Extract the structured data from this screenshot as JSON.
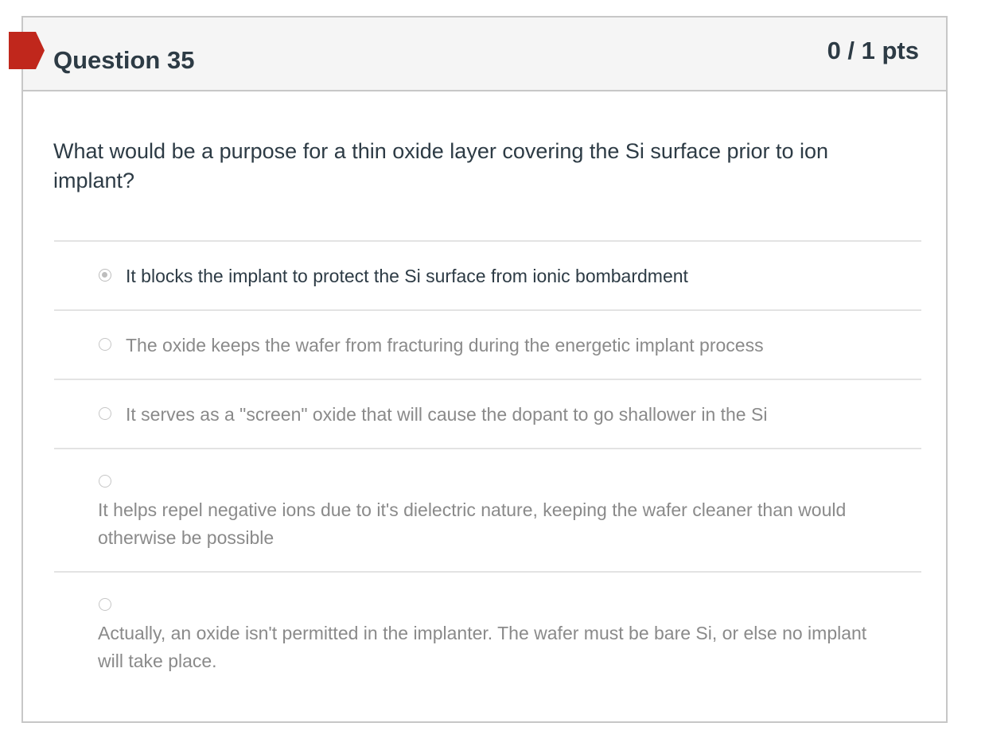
{
  "question": {
    "title": "Question 35",
    "points": "0 / 1 pts",
    "text": "What would be a purpose for a thin oxide layer covering the Si surface prior to ion implant?",
    "flag_color": "#c0271c"
  },
  "answers": [
    {
      "label": "It blocks the implant to protect the Si surface from ionic bombardment",
      "selected": true
    },
    {
      "label": "The oxide keeps the wafer from fracturing during the energetic implant process",
      "selected": false
    },
    {
      "label": "It serves as a \"screen\" oxide that will cause the dopant to go shallower in the Si",
      "selected": false
    },
    {
      "label": "It helps repel negative ions due to it's dielectric nature, keeping the wafer cleaner than would otherwise be possible",
      "selected": false
    },
    {
      "label": "Actually, an oxide isn't permitted in the implanter.  The wafer must be bare Si, or else no implant will take place.",
      "selected": false
    }
  ]
}
